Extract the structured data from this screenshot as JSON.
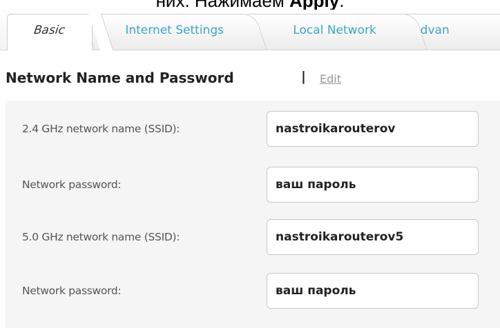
{
  "caption": {
    "text": "них. Нажимаем ",
    "bold": "Apply",
    "end": "."
  },
  "tabs": [
    {
      "label": "Basic",
      "active": true
    },
    {
      "label": "Internet Settings",
      "active": false
    },
    {
      "label": "Local Network",
      "active": false
    },
    {
      "label": "Advan",
      "active": false
    }
  ],
  "section": {
    "title": "Network Name and Password",
    "separator": "|",
    "edit_label": "Edit"
  },
  "fields": [
    {
      "label": "2.4 GHz network name (SSID):",
      "value": "nastroikarouterov"
    },
    {
      "label": "Network password:",
      "value": "ваш пароль"
    },
    {
      "label": "5.0 GHz network name (SSID):",
      "value": "nastroikarouterov5"
    },
    {
      "label": "Network password:",
      "value": "ваш пароль"
    }
  ],
  "colors": {
    "tab_inactive_text": "#3aa5c8",
    "tab_active_text": "#333333",
    "panel_bg": "#f5f5f5",
    "edit_link": "#999999"
  }
}
